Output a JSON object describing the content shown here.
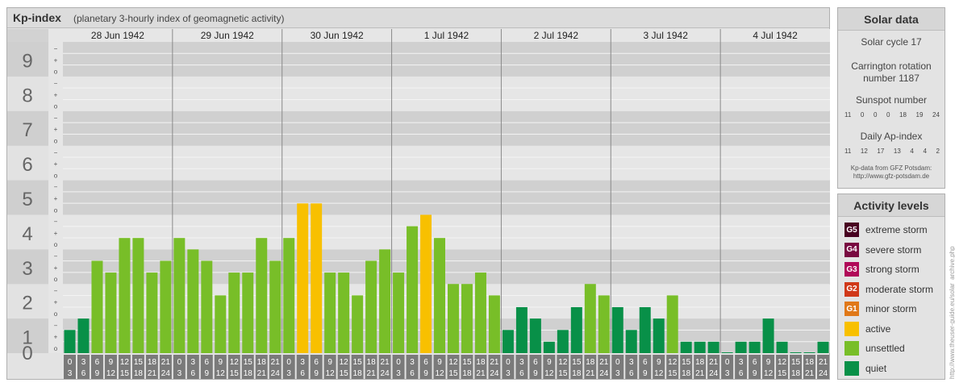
{
  "title": "Kp-index",
  "subtitle": "(planetary 3-hourly index of geomagnetic activity)",
  "colors": {
    "quiet": "#089048",
    "unsettled": "#78be28",
    "active": "#f8c000",
    "minor_storm": "#e07818",
    "moderate_storm": "#d03818",
    "strong_storm": "#b00858",
    "severe_storm": "#780840",
    "extreme_storm": "#480020"
  },
  "chart_data": {
    "type": "bar",
    "ylim": [
      0,
      9
    ],
    "y_ticks": [
      "0",
      "1",
      "2",
      "3",
      "4",
      "5",
      "6",
      "7",
      "8",
      "9"
    ],
    "minor_tick_marks": [
      "o",
      "+",
      "−"
    ],
    "days": [
      "28 Jun 1942",
      "29 Jun 1942",
      "30 Jun 1942",
      "1 Jul 1942",
      "2 Jul 1942",
      "3 Jul 1942",
      "4 Jul 1942"
    ],
    "interval_labels": [
      [
        "0",
        "3"
      ],
      [
        "3",
        "6"
      ],
      [
        "6",
        "9"
      ],
      [
        "9",
        "12"
      ],
      [
        "12",
        "15"
      ],
      [
        "15",
        "18"
      ],
      [
        "18",
        "21"
      ],
      [
        "21",
        "24"
      ]
    ],
    "values": [
      0.67,
      1.0,
      2.67,
      2.33,
      3.33,
      3.33,
      2.33,
      2.67,
      3.33,
      3.0,
      2.67,
      1.67,
      2.33,
      2.33,
      3.33,
      2.67,
      3.33,
      4.33,
      4.33,
      2.33,
      2.33,
      1.67,
      2.67,
      3.0,
      2.33,
      3.67,
      4.0,
      3.33,
      2.0,
      2.0,
      2.33,
      1.67,
      0.67,
      1.33,
      1.0,
      0.33,
      0.67,
      1.33,
      2.0,
      1.67,
      1.33,
      0.67,
      1.33,
      1.0,
      1.67,
      0.33,
      0.33,
      0.33,
      0.0,
      0.33,
      0.33,
      1.0,
      0.33,
      0.0,
      0.0,
      0.33
    ],
    "categories_levels": [
      "quiet",
      "unsettled",
      "active"
    ]
  },
  "solar": {
    "heading": "Solar data",
    "cycle": "Solar cycle 17",
    "carrington_line1": "Carrington rotation",
    "carrington_line2": "number 1187",
    "sunspot_heading": "Sunspot number",
    "sunspot_values": [
      "11",
      "0",
      "0",
      "0",
      "18",
      "19",
      "24"
    ],
    "ap_heading": "Daily Ap-index",
    "ap_values": [
      "11",
      "12",
      "17",
      "13",
      "4",
      "4",
      "2"
    ],
    "credit_line1": "Kp-data from GFZ Potsdam:",
    "credit_line2": "http://www.gfz-potsdam.de"
  },
  "activity": {
    "heading": "Activity levels",
    "levels": [
      {
        "badge": "G5",
        "label": "extreme storm",
        "color": "#480020"
      },
      {
        "badge": "G4",
        "label": "severe storm",
        "color": "#780840"
      },
      {
        "badge": "G3",
        "label": "strong storm",
        "color": "#b00858"
      },
      {
        "badge": "G2",
        "label": "moderate storm",
        "color": "#d03818"
      },
      {
        "badge": "G1",
        "label": "minor storm",
        "color": "#e07818"
      },
      {
        "badge": "",
        "label": "active",
        "color": "#f8c000"
      },
      {
        "badge": "",
        "label": "unsettled",
        "color": "#78be28"
      },
      {
        "badge": "",
        "label": "quiet",
        "color": "#089048"
      }
    ]
  },
  "watermark": "http://www.theuser-guide.eu/solar_archive.php"
}
